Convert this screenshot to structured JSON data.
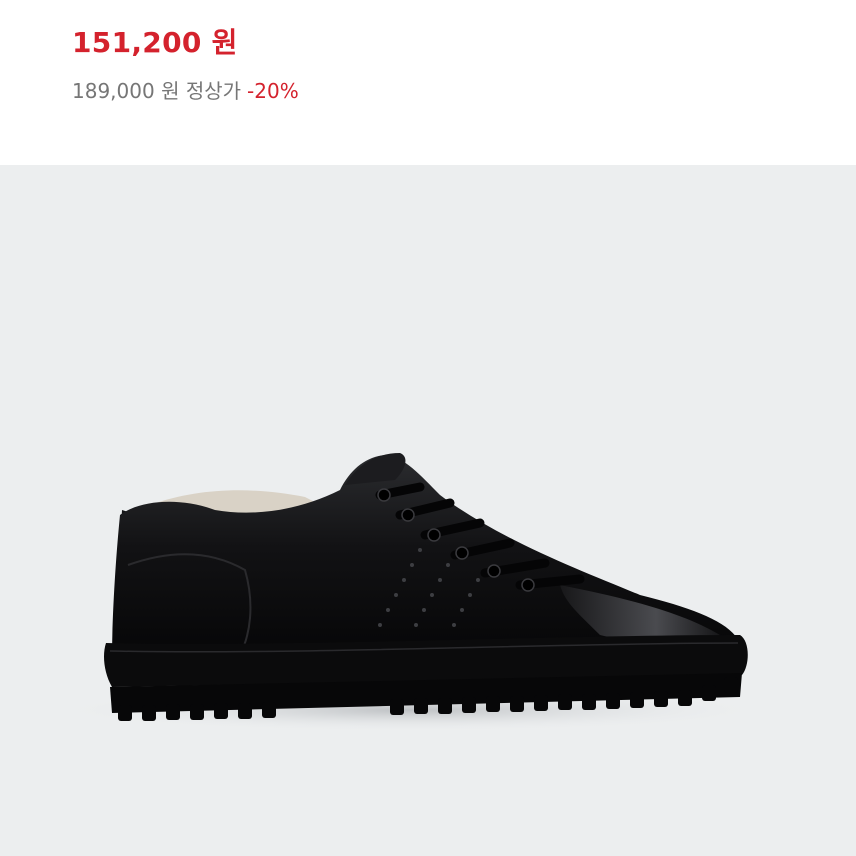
{
  "product": {
    "sale_price": "151,200 원",
    "original_price": "189,000 원 정상가",
    "discount": "-20%",
    "image": {
      "icon": "black-leather-sneaker-image",
      "background_color": "#eceeef",
      "shoe_color": "#0e0e10"
    }
  }
}
